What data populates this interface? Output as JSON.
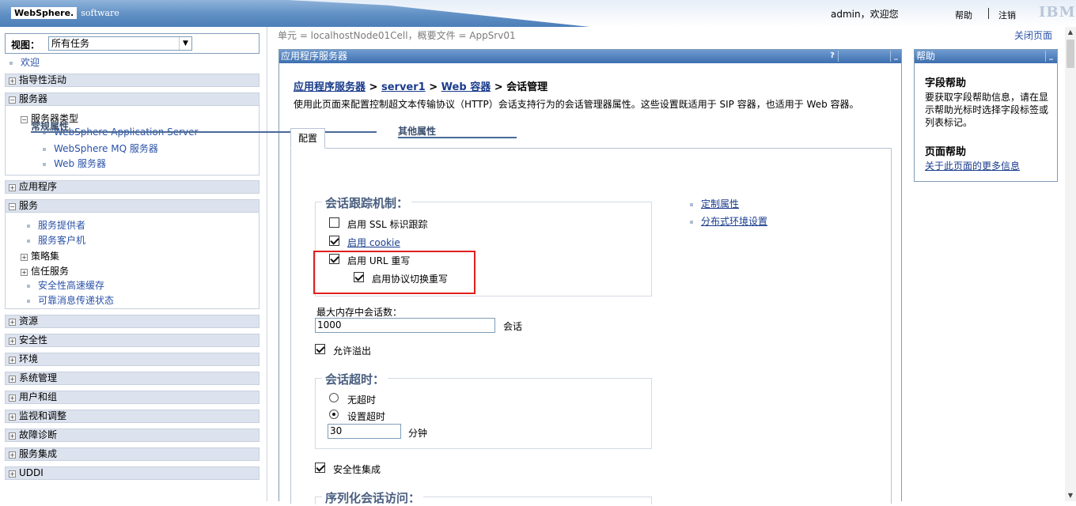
{
  "header": {
    "logo_brand": "WebSphere.",
    "logo_software": "software",
    "user_greeting": "admin，欢迎您",
    "help": "帮助",
    "logout": "注销",
    "ibm": "IBM."
  },
  "nav": {
    "view_label": "视图：",
    "view_value": "所有任务",
    "welcome": "欢迎",
    "categories": [
      {
        "label": "指导性活动",
        "expanded": false
      },
      {
        "label": "服务器",
        "expanded": true
      },
      {
        "label": "应用程序",
        "expanded": false
      },
      {
        "label": "服务",
        "expanded": true
      },
      {
        "label": "资源",
        "expanded": false
      },
      {
        "label": "安全性",
        "expanded": false
      },
      {
        "label": "环境",
        "expanded": false
      },
      {
        "label": "系统管理",
        "expanded": false
      },
      {
        "label": "用户和组",
        "expanded": false
      },
      {
        "label": "监视和调整",
        "expanded": false
      },
      {
        "label": "故障诊断",
        "expanded": false
      },
      {
        "label": "服务集成",
        "expanded": false
      },
      {
        "label": "UDDI",
        "expanded": false
      }
    ],
    "servers": {
      "server_types": "服务器类型",
      "items": [
        "WebSphere Application Server",
        "WebSphere MQ 服务器",
        "Web 服务器"
      ]
    },
    "services": {
      "items": [
        "服务提供者",
        "服务客户机"
      ],
      "policy_sets": "策略集",
      "trust_service": "信任服务",
      "items2": [
        "安全性高速缓存",
        "可靠消息传递状态"
      ]
    }
  },
  "main": {
    "scope": "单元 = localhostNode01Cell，概要文件 = AppSrv01",
    "close_page": "关闭页面",
    "panel_title": "应用程序服务器",
    "panel_help_btn": "?",
    "panel_min_btn": "_",
    "breadcrumb": {
      "l1": "应用程序服务器",
      "l2": "server1",
      "l3": "Web 容器",
      "sep": ">",
      "current": "会话管理"
    },
    "description": "使用此页面来配置控制超文本传输协议（HTTP）会话支持行为的会话管理器属性。这些设置既适用于 SIP 容器，也适用于 Web 容器。",
    "tab": "配置",
    "general_props": "常规属性",
    "tracking": {
      "legend": "会话跟踪机制：",
      "ssl": "启用 SSL 标识跟踪",
      "ssl_checked": false,
      "cookie": "启用 cookie",
      "cookie_checked": true,
      "url_rewrite": "启用 URL 重写",
      "url_checked": true,
      "protocol_switch": "启用协议切换重写",
      "protocol_checked": true
    },
    "max_sessions_label": "最大内存中会话数：",
    "max_sessions_value": "1000",
    "sessions_unit": "会话",
    "allow_overflow": "允许溢出",
    "allow_overflow_checked": true,
    "timeout": {
      "legend": "会话超时：",
      "no_timeout": "无超时",
      "set_timeout": "设置超时",
      "selected": "set_timeout",
      "value": "30",
      "unit": "分钟"
    },
    "security_integration": "安全性集成",
    "security_integration_checked": true,
    "serialize_legend": "序列化会话访问：",
    "other_props": "其他属性",
    "other_links": [
      "定制属性",
      "分布式环境设置"
    ]
  },
  "help_panel": {
    "title": "帮助",
    "min_btn": "_",
    "field_help_h": "字段帮助",
    "field_help_t": "要获取字段帮助信息，请在显示帮助光标时选择字段标签或列表标记。",
    "page_help_h": "页面帮助",
    "page_help_link": "关于此页面的更多信息"
  },
  "scrollbar": {
    "up": "▲",
    "down": "▼"
  }
}
